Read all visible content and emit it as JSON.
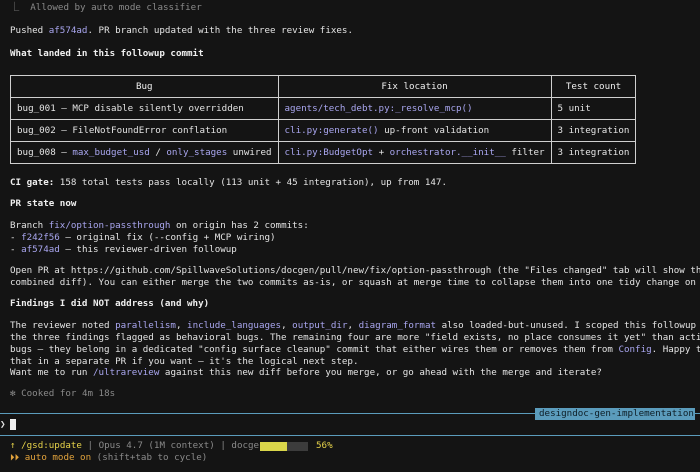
{
  "top_status": {
    "icon": "⎿",
    "text": "Allowed by auto mode classifier"
  },
  "pushed": {
    "pre": "Pushed ",
    "commit": "af574ad",
    "post": ". PR branch updated with the three review fixes."
  },
  "landed_heading": "What landed in this followup commit",
  "table": {
    "headers": [
      "Bug",
      "Fix location",
      "Test count"
    ],
    "rows": [
      {
        "bug_pre": "bug_001 — MCP disable silently overridden",
        "bug_c1": "",
        "bug_mid": "",
        "bug_c2": "",
        "bug_post": "",
        "fix_c1": "agents/tech_debt.py:_resolve_mcp()",
        "fix_mid": "",
        "fix_c2": "",
        "fix_post": "",
        "count": "5 unit"
      },
      {
        "bug_pre": "bug_002 — FileNotFoundError conflation",
        "bug_c1": "",
        "bug_mid": "",
        "bug_c2": "",
        "bug_post": "",
        "fix_c1": "cli.py:generate()",
        "fix_mid": " up-front validation",
        "fix_c2": "",
        "fix_post": "",
        "count": "3 integration"
      },
      {
        "bug_pre": "bug_008 — ",
        "bug_c1": "max_budget_usd",
        "bug_mid": " / ",
        "bug_c2": "only_stages",
        "bug_post": " unwired",
        "fix_c1": "cli.py:BudgetOpt",
        "fix_mid": " + ",
        "fix_c2": "orchestrator.__init__",
        "fix_post": " filter",
        "count": "3 integration"
      }
    ]
  },
  "ci_gate": {
    "label": "CI gate:",
    "text": " 158 total tests pass locally (113 unit + 45 integration), up from 147."
  },
  "pr_state_heading": "PR state now",
  "branch": {
    "pre": "Branch ",
    "name": "fix/option-passthrough",
    "post": " on origin has 2 commits:"
  },
  "commits": [
    {
      "prefix": "- ",
      "hash": "f242f56",
      "text": " — original fix (--config + MCP wiring)"
    },
    {
      "prefix": "- ",
      "hash": "af574ad",
      "text": " — this reviewer-driven followup"
    }
  ],
  "open_pr": {
    "line1": "Open PR at https://github.com/SpillwaveSolutions/docgen/pull/new/fix/option-passthrough (the \"Files changed\" tab will show the",
    "line2_pre": "combined diff). You can either merge the two commits as-is, or squash at merge time to collapse them into one tidy change on ",
    "line2_code": "main",
    "line2_post": "."
  },
  "findings_heading": "Findings I did NOT address (and why)",
  "findings": {
    "l1_pre": "The reviewer noted ",
    "c1": "parallelism",
    "s1": ", ",
    "c2": "include_languages",
    "s2": ", ",
    "c3": "output_dir",
    "s3": ", ",
    "c4": "diagram_format",
    "l1_post": " also loaded-but-unused. I scoped this followup to",
    "line2": "the three findings flagged as behavioral bugs. The remaining four are more \"field exists, no place consumes it yet\" than active",
    "line3_pre": "bugs — they belong in a dedicated \"config surface cleanup\" commit that either wires them or removes them from ",
    "line3_code": "Config",
    "line3_post": ". Happy to do",
    "line4": "that in a separate PR if you want — it's the logical next step."
  },
  "question": {
    "pre": "Want me to run ",
    "code": "/ultrareview",
    "post": " against this new diff before you merge, or go ahead with the merge and iterate?"
  },
  "cooked": {
    "icon": "✻",
    "text": "Cooked for 4m 18s"
  },
  "session_tag": "designdoc-gen-implementation",
  "prompt_symbol": "❯",
  "statusbar": {
    "arrow": "↑",
    "command": "/gsd:update",
    "sep1": "|",
    "model": "Opus 4.7 (1M context)",
    "sep2": "|",
    "project": "docgen",
    "percent_label": "56%",
    "percent": 0.56,
    "mode_icon": "⏵⏵",
    "mode_text": "auto mode on",
    "mode_hint": "(shift+tab to cycle)"
  }
}
